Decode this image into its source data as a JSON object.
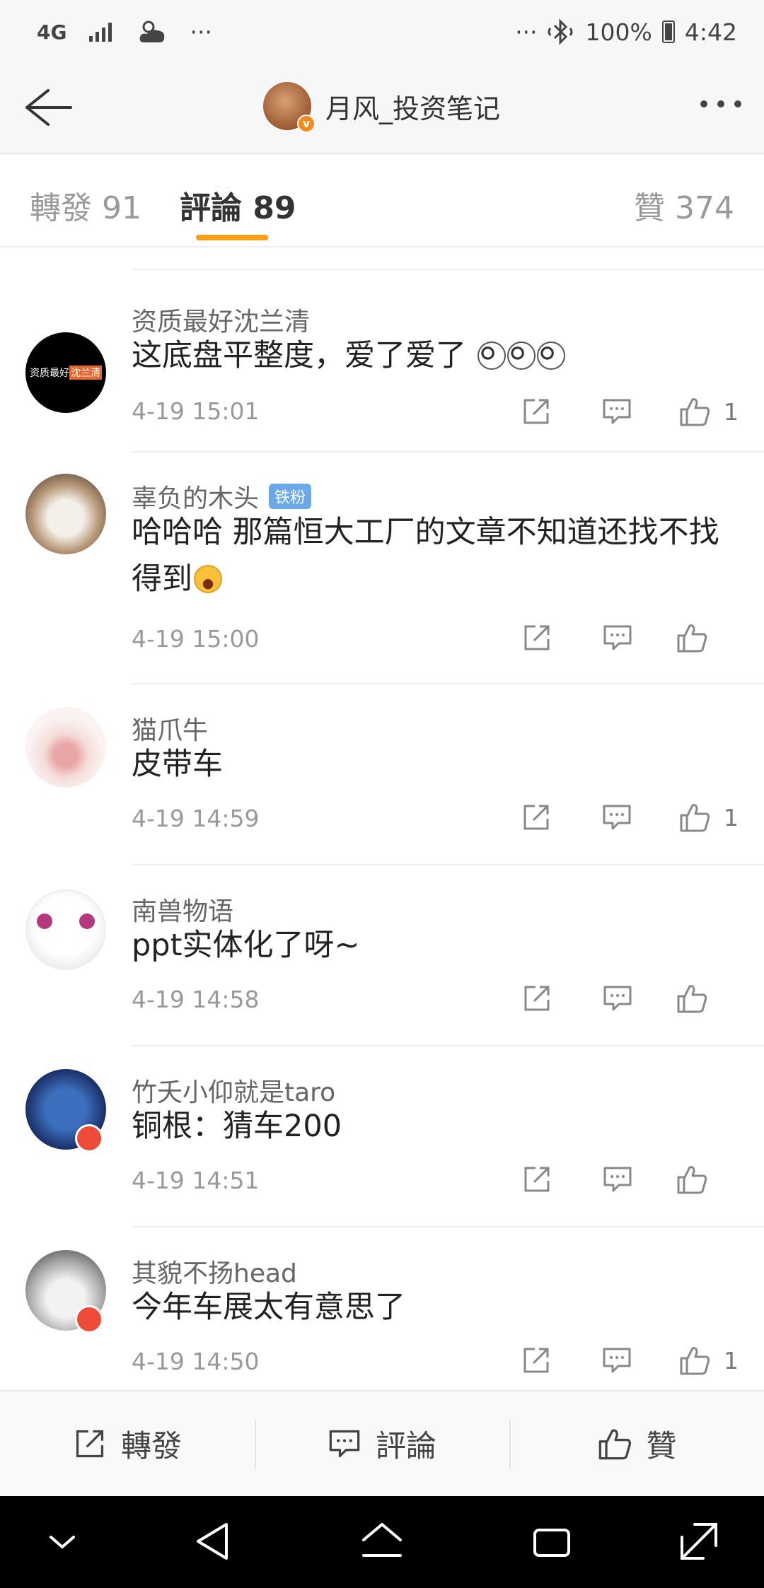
{
  "status_bar": {
    "network": "4G",
    "dots_left": "···",
    "dots_right": "···",
    "battery": "100%",
    "time": "4:42"
  },
  "header": {
    "title": "月风_投资笔记",
    "verified_badge": "v"
  },
  "tabs": {
    "reposts": "轉發 91",
    "comments": "評論 89",
    "likes": "贊 374",
    "active_color": "#f79d17"
  },
  "comments": [
    {
      "name": "资质最好沈兰清",
      "text": "这底盘平整度，爱了爱了",
      "time": "4-19 15:01",
      "likes": "1",
      "avatar_text_white": "资质最好",
      "avatar_text_orange": "沈兰清"
    },
    {
      "name": "辜负的木头",
      "badge": "铁粉",
      "text": "哈哈哈 那篇恒大工厂的文章不知道还找不找得到",
      "time": "4-19 15:00",
      "likes": ""
    },
    {
      "name": "猫爪牛",
      "text": "皮带车",
      "time": "4-19 14:59",
      "likes": "1"
    },
    {
      "name": "南兽物语",
      "text": "ppt实体化了呀~",
      "time": "4-19 14:58",
      "likes": ""
    },
    {
      "name": "竹夭小仰就是taro",
      "text": "铜根：猜车200",
      "time": "4-19 14:51",
      "likes": ""
    },
    {
      "name": "其貌不扬head",
      "text": "今年车展太有意思了",
      "time": "4-19 14:50",
      "likes": "1"
    }
  ],
  "bottom_bar": {
    "repost": "轉發",
    "comment": "評論",
    "like": "贊"
  },
  "icons": {
    "back": "back-arrow-icon",
    "more": "more-dots-icon",
    "repost": "share-out-icon",
    "comment": "comment-bubble-icon",
    "like": "thumbs-up-icon"
  }
}
